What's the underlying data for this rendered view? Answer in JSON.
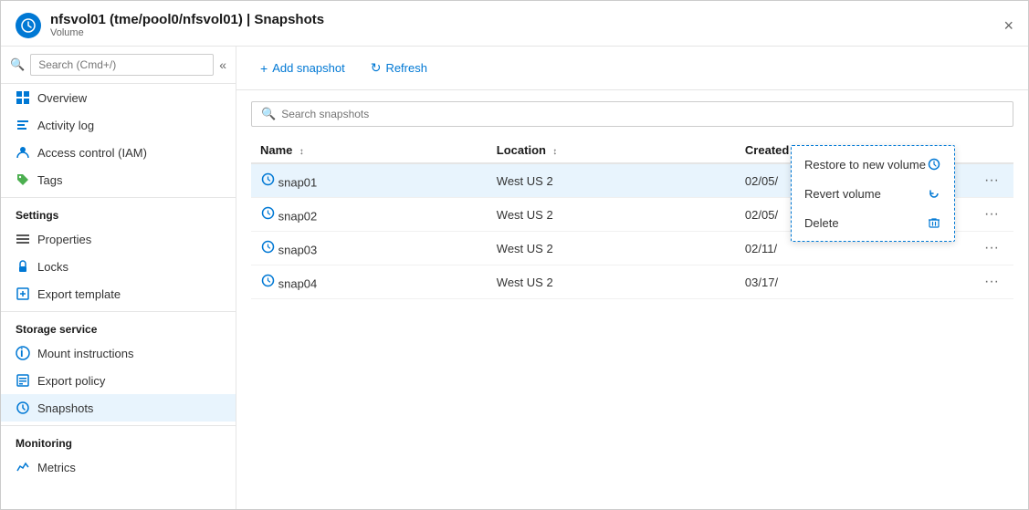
{
  "window": {
    "title": "nfsvol01 (tme/pool0/nfsvol01) | Snapshots",
    "subtitle": "Volume",
    "close_label": "×"
  },
  "sidebar": {
    "search_placeholder": "Search (Cmd+/)",
    "collapse_icon": "«",
    "nav_items": [
      {
        "id": "overview",
        "label": "Overview",
        "icon": "overview"
      },
      {
        "id": "activity-log",
        "label": "Activity log",
        "icon": "activitylog"
      },
      {
        "id": "iam",
        "label": "Access control (IAM)",
        "icon": "iam"
      },
      {
        "id": "tags",
        "label": "Tags",
        "icon": "tags"
      }
    ],
    "sections": [
      {
        "title": "Settings",
        "items": [
          {
            "id": "properties",
            "label": "Properties",
            "icon": "properties"
          },
          {
            "id": "locks",
            "label": "Locks",
            "icon": "locks"
          },
          {
            "id": "export-template",
            "label": "Export template",
            "icon": "exporttemplate"
          }
        ]
      },
      {
        "title": "Storage service",
        "items": [
          {
            "id": "mount-instructions",
            "label": "Mount instructions",
            "icon": "mountinstr"
          },
          {
            "id": "export-policy",
            "label": "Export policy",
            "icon": "exportpolicy"
          },
          {
            "id": "snapshots",
            "label": "Snapshots",
            "icon": "snapshots",
            "active": true
          }
        ]
      },
      {
        "title": "Monitoring",
        "items": [
          {
            "id": "metrics",
            "label": "Metrics",
            "icon": "metrics"
          }
        ]
      }
    ]
  },
  "toolbar": {
    "add_snapshot_label": "Add snapshot",
    "refresh_label": "Refresh"
  },
  "table": {
    "search_placeholder": "Search snapshots",
    "columns": [
      {
        "id": "name",
        "label": "Name"
      },
      {
        "id": "location",
        "label": "Location"
      },
      {
        "id": "created",
        "label": "Created"
      }
    ],
    "rows": [
      {
        "id": "snap01",
        "name": "snap01",
        "location": "West US 2",
        "created": "02/05/",
        "selected": true
      },
      {
        "id": "snap02",
        "name": "snap02",
        "location": "West US 2",
        "created": "02/05/"
      },
      {
        "id": "snap03",
        "name": "snap03",
        "location": "West US 2",
        "created": "02/11/"
      },
      {
        "id": "snap04",
        "name": "snap04",
        "location": "West US 2",
        "created": "03/17/"
      }
    ]
  },
  "context_menu": {
    "items": [
      {
        "id": "restore-to-new-volume",
        "label": "Restore to new volume",
        "icon": "restore"
      },
      {
        "id": "revert-volume",
        "label": "Revert volume",
        "icon": "revert"
      },
      {
        "id": "delete",
        "label": "Delete",
        "icon": "delete"
      }
    ]
  }
}
